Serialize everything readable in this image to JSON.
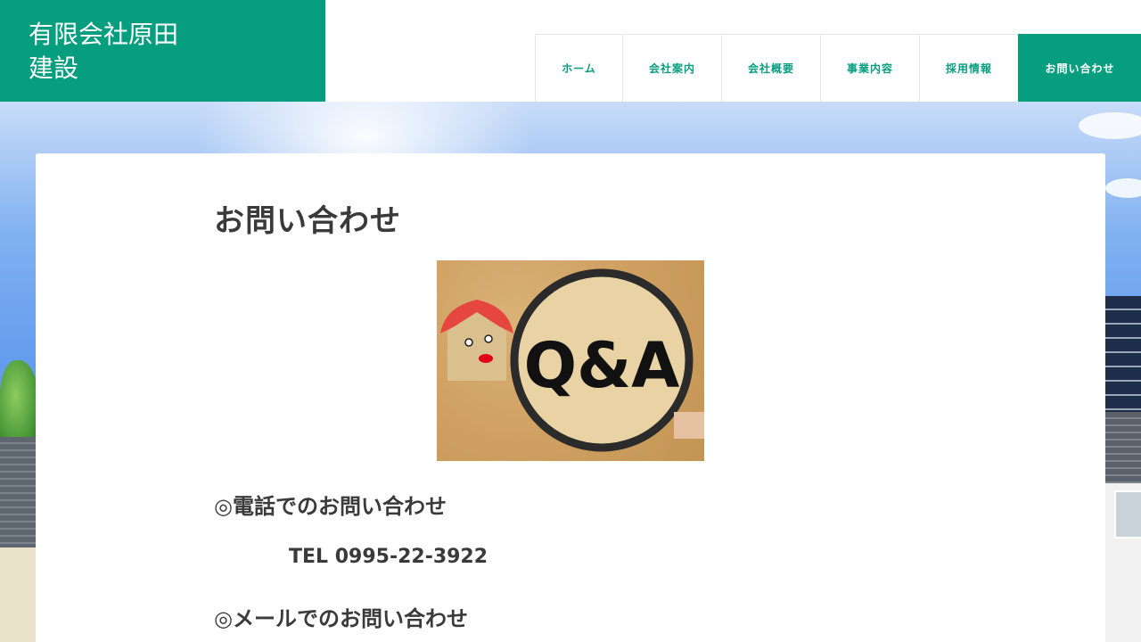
{
  "site": {
    "name": "有限会社原田建設",
    "name_line1": "有限会社原田",
    "name_line2": "建設"
  },
  "nav": {
    "items": [
      {
        "label": "ホーム"
      },
      {
        "label": "会社案内"
      },
      {
        "label": "会社概要"
      },
      {
        "label": "事業内容"
      },
      {
        "label": "採用情報"
      },
      {
        "label": "お問い合わせ",
        "active": true
      }
    ]
  },
  "colors": {
    "brand": "#079e7f",
    "text": "#3a3a3a",
    "sky": "#5c97ee"
  },
  "main": {
    "title": "お問い合わせ",
    "image": {
      "icon": "qa-magnifier-image",
      "overlay_text": "Q&A"
    },
    "phone_section": {
      "heading": "◎電話でのお問い合わせ",
      "tel": "TEL 0995-22-3922"
    },
    "mail_section": {
      "heading": "◎メールでのお問い合わせ"
    }
  }
}
